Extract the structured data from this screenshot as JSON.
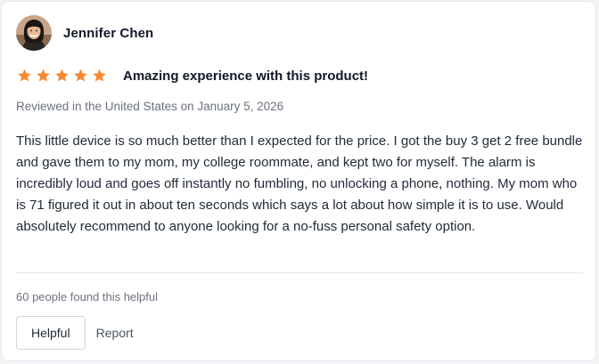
{
  "reviewer": {
    "name": "Jennifer Chen",
    "avatar_icon": "person-avatar-icon"
  },
  "rating": {
    "stars": 5,
    "max": 5,
    "star_color": "#f58a33"
  },
  "review": {
    "title": "Amazing experience with this product!",
    "meta": "Reviewed in the United States on January 5, 2026",
    "body": "This little device is so much better than I expected for the price. I got the buy 3 get 2 free bundle and gave them to my mom, my college roommate, and kept two for myself. The alarm is incredibly loud and goes off instantly no fumbling, no unlocking a phone, nothing. My mom who is 71 figured it out in about ten seconds which says a lot about how simple it is to use. Would absolutely recommend to anyone looking for a no-fuss personal safety option."
  },
  "feedback": {
    "helpful_count_text": "60 people found this helpful",
    "helpful_label": "Helpful",
    "report_label": "Report"
  }
}
